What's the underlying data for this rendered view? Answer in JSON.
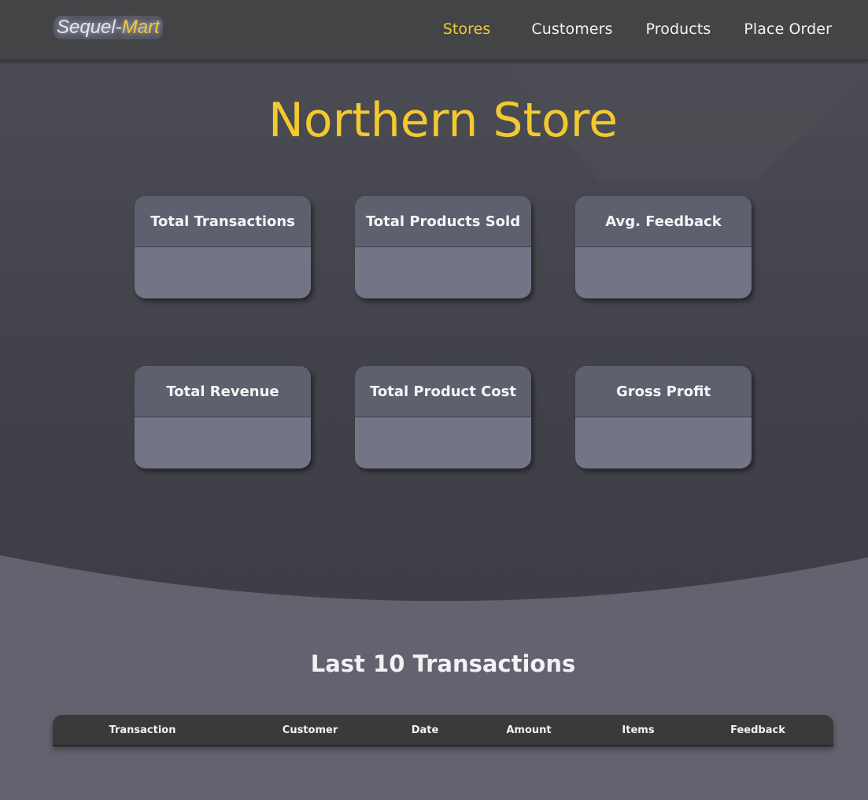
{
  "brand": {
    "name_part1": "Sequel",
    "separator": "-",
    "name_part2": "Mart"
  },
  "nav": {
    "items": [
      {
        "label": "Stores",
        "active": true
      },
      {
        "label": "Customers",
        "active": false
      },
      {
        "label": "Products",
        "active": false
      },
      {
        "label": "Place Order",
        "active": false
      }
    ]
  },
  "store": {
    "title": "Northern Store"
  },
  "stats": [
    {
      "label": "Total Transactions",
      "value": ""
    },
    {
      "label": "Total Products Sold",
      "value": ""
    },
    {
      "label": "Avg. Feedback",
      "value": ""
    },
    {
      "label": "Total Revenue",
      "value": ""
    },
    {
      "label": "Total Product Cost",
      "value": ""
    },
    {
      "label": "Gross Profit",
      "value": ""
    }
  ],
  "transactions": {
    "title": "Last 10 Transactions",
    "columns": [
      "Transaction",
      "Customer",
      "Date",
      "Amount",
      "Items",
      "Feedback"
    ],
    "rows": []
  },
  "colors": {
    "accent": "#f3c930",
    "navbar": "#434446",
    "card_head": "#5f606e",
    "card_body": "#737586",
    "table_header": "#393a39",
    "page_bottom": "#63636f"
  }
}
